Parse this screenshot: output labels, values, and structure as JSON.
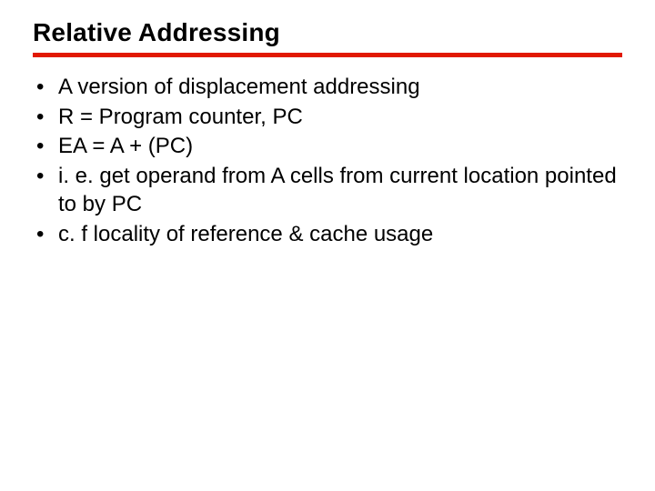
{
  "title": "Relative Addressing",
  "bullets": [
    "A version of displacement addressing",
    "R = Program counter, PC",
    "EA = A + (PC)",
    "i. e. get operand from A cells from current location pointed to by PC",
    "c. f locality of reference & cache usage"
  ],
  "accent_color": "#e11900"
}
